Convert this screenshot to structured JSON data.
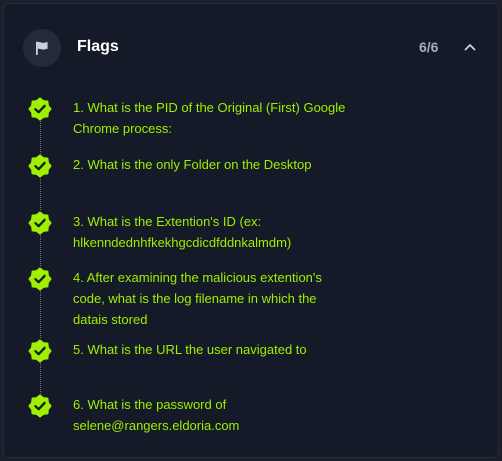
{
  "header": {
    "title": "Flags",
    "progress": "6/6",
    "completed": 6,
    "total": 6,
    "flag_icon": "flag-icon",
    "collapse_icon": "chevron-up-icon"
  },
  "colors": {
    "accent_green": "#9fef00",
    "panel_bg": "#141a27",
    "page_bg": "#1a1f2b"
  },
  "flags": [
    {
      "status": "completed",
      "lines": [
        "1. What is the PID of the Original (First) Google",
        "Chrome process:"
      ]
    },
    {
      "status": "completed",
      "lines": [
        "2. What is the only Folder on the Desktop"
      ]
    },
    {
      "status": "completed",
      "lines": [
        "3. What is the Extention's ID (ex:",
        "hlkenndednhfkekhgcdicdfddnkalmdm)"
      ]
    },
    {
      "status": "completed",
      "lines": [
        "4. After examining the malicious extention's",
        "code, what is the log filename in which the",
        "datais stored"
      ]
    },
    {
      "status": "completed",
      "lines": [
        "5. What is the URL the user navigated to"
      ]
    },
    {
      "status": "completed",
      "lines": [
        "6. What is the password of",
        "selene@rangers.eldoria.com"
      ]
    }
  ]
}
